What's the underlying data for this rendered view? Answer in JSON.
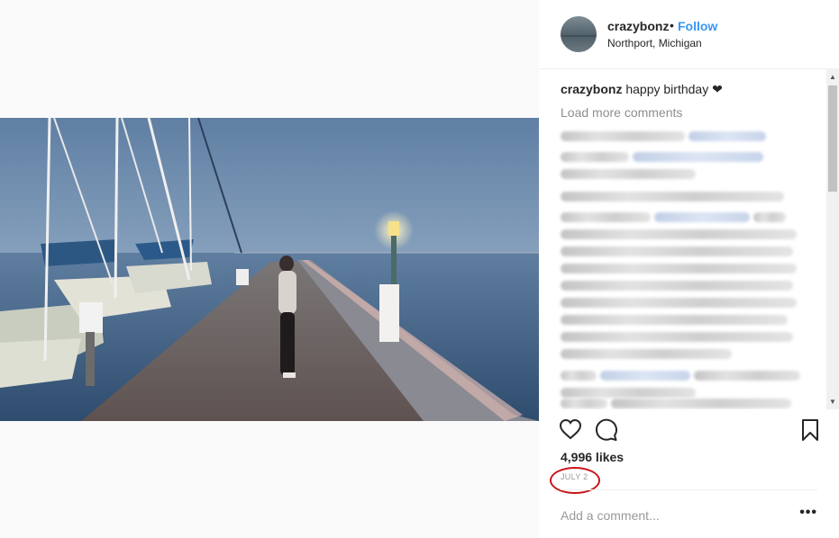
{
  "post": {
    "username": "crazybonz",
    "separator": "•",
    "follow_label": "Follow",
    "location": "Northport, Michigan"
  },
  "caption": {
    "username": "crazybonz",
    "text": "happy birthday ❤"
  },
  "load_more_label": "Load more comments",
  "likes": "4,996 likes",
  "date": "JULY 2",
  "comment_placeholder": "Add a comment...",
  "more_label": "•••",
  "scroll_up": "▲",
  "scroll_down": "▼",
  "colors": {
    "link_blue": "#3897f0",
    "annotation_red": "#c8151b",
    "muted_text": "#8e8e8e"
  },
  "icons": [
    "heart-icon",
    "comment-icon",
    "bookmark-icon",
    "more-options-icon"
  ]
}
